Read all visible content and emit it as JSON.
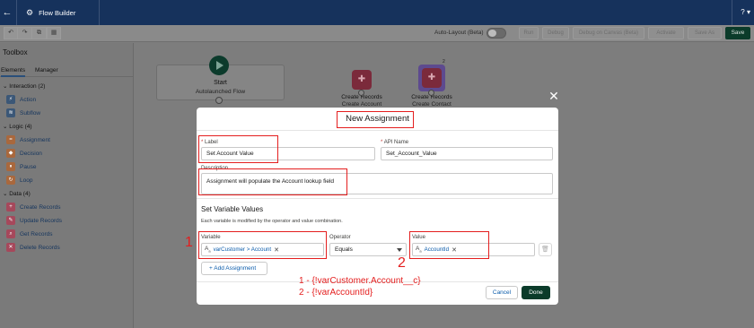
{
  "header": {
    "app_title": "Flow Builder",
    "help_label": "?"
  },
  "toolbar": {
    "undo_label": "↶",
    "redo_label": "↷",
    "copy_label": "⧉",
    "paste_label": "▦",
    "autolayout_label": "Auto-Layout (Beta)",
    "buttons": [
      "Run",
      "Debug",
      "Debug on Canvas (Beta)",
      "Activate",
      "Save As"
    ],
    "save_label": "Save"
  },
  "toolbox": {
    "title": "Toolbox",
    "tabs": [
      "Elements",
      "Manager"
    ],
    "sections": [
      {
        "title": "Interaction (2)",
        "items": [
          {
            "label": "Action",
            "icon": "action-icon"
          },
          {
            "label": "Subflow",
            "icon": "subflow-icon"
          }
        ]
      },
      {
        "title": "Logic (4)",
        "items": [
          {
            "label": "Assignment",
            "icon": "assignment-icon"
          },
          {
            "label": "Decision",
            "icon": "decision-icon"
          },
          {
            "label": "Pause",
            "icon": "pause-icon"
          },
          {
            "label": "Loop",
            "icon": "loop-icon"
          }
        ]
      },
      {
        "title": "Data (4)",
        "items": [
          {
            "label": "Create Records",
            "icon": "create-records-icon"
          },
          {
            "label": "Update Records",
            "icon": "update-records-icon"
          },
          {
            "label": "Get Records",
            "icon": "get-records-icon"
          },
          {
            "label": "Delete Records",
            "icon": "delete-records-icon"
          }
        ]
      }
    ]
  },
  "canvas": {
    "start_title": "Start",
    "start_subtitle": "Autolaunched Flow",
    "element1_title": "Create Records",
    "element1_subtitle": "Create Account",
    "element2_title": "Create Records",
    "element2_subtitle": "Create Contact",
    "badge": "2"
  },
  "modal": {
    "title": "New Assignment",
    "label_field_label": "Label",
    "label_value": "Set Account Value",
    "api_name_label": "API Name",
    "api_name_value": "Set_Account_Value",
    "description_label": "Description",
    "description_value": "Assignment will populate the Account lookup field",
    "section_title": "Set Variable Values",
    "section_desc": "Each variable is modified by the operator and value combination.",
    "variable_label": "Variable",
    "variable_value": "varCustomer > Account",
    "operator_label": "Operator",
    "operator_value": "Equals",
    "value_label": "Value",
    "value_value": "AccountId",
    "add_assignment_label": "Add Assignment",
    "cancel_label": "Cancel",
    "done_label": "Done",
    "required_mark": "*",
    "text_type_icon": "A",
    "text_type_sub": "a"
  },
  "annotations": {
    "num1": "1",
    "num2": "2",
    "note_line1": "1 - {!varCustomer.Account__c}",
    "note_line2": "2 - {!varAccountId}",
    "color": "#e41e1e"
  },
  "colors": {
    "header_bg": "#16325c",
    "save_bg": "#0b3b2a",
    "link": "#0b5cab"
  }
}
